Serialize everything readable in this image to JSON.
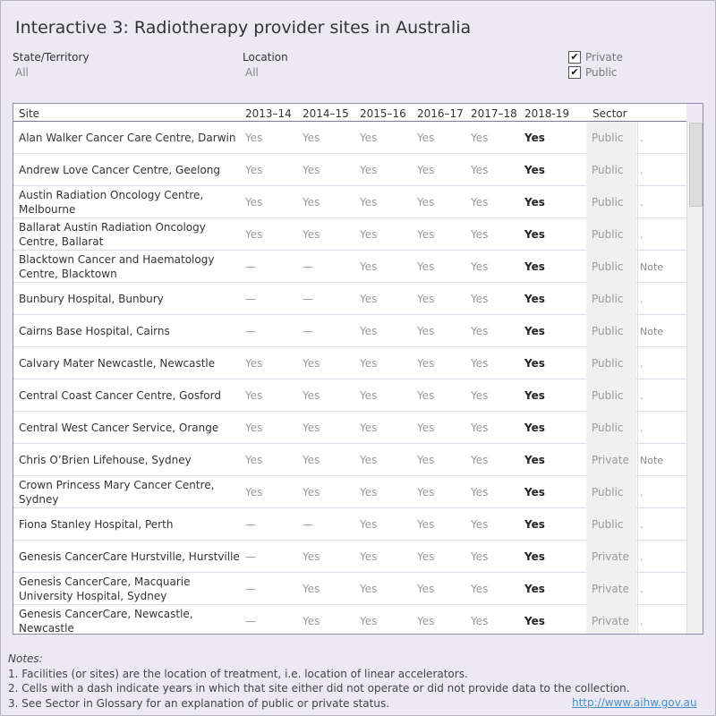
{
  "title": "Interactive 3: Radiotherapy provider sites in Australia",
  "filters": {
    "state": {
      "label": "State/Territory",
      "value": "All"
    },
    "location": {
      "label": "Location",
      "value": "All"
    }
  },
  "legend": {
    "private": {
      "label": "Private",
      "checked": "✔"
    },
    "public": {
      "label": "Public",
      "checked": "✔"
    }
  },
  "table": {
    "headers": [
      "Site",
      "2013–14",
      "2014–15",
      "2015–16",
      "2016–17",
      "2017–18",
      "2018-19",
      "Sector"
    ],
    "rows": [
      {
        "site": "Alan Walker Cancer Care Centre, Darwin",
        "years": [
          "Yes",
          "Yes",
          "Yes",
          "Yes",
          "Yes",
          "Yes"
        ],
        "sector": "Public",
        "note": "."
      },
      {
        "site": "Andrew Love Cancer Centre, Geelong",
        "years": [
          "Yes",
          "Yes",
          "Yes",
          "Yes",
          "Yes",
          "Yes"
        ],
        "sector": "Public",
        "note": "."
      },
      {
        "site": "Austin Radiation Oncology Centre, Melbourne",
        "years": [
          "Yes",
          "Yes",
          "Yes",
          "Yes",
          "Yes",
          "Yes"
        ],
        "sector": "Public",
        "note": "."
      },
      {
        "site": "Ballarat Austin Radiation Oncology Centre, Ballarat",
        "years": [
          "Yes",
          "Yes",
          "Yes",
          "Yes",
          "Yes",
          "Yes"
        ],
        "sector": "Public",
        "note": "."
      },
      {
        "site": "Blacktown Cancer and Haematology Centre, Blacktown",
        "years": [
          "—",
          "—",
          "Yes",
          "Yes",
          "Yes",
          "Yes"
        ],
        "sector": "Public",
        "note": "Note"
      },
      {
        "site": "Bunbury Hospital, Bunbury",
        "years": [
          "—",
          "—",
          "Yes",
          "Yes",
          "Yes",
          "Yes"
        ],
        "sector": "Public",
        "note": "."
      },
      {
        "site": "Cairns Base Hospital, Cairns",
        "years": [
          "—",
          "—",
          "Yes",
          "Yes",
          "Yes",
          "Yes"
        ],
        "sector": "Public",
        "note": "Note"
      },
      {
        "site": "Calvary Mater Newcastle, Newcastle",
        "years": [
          "Yes",
          "Yes",
          "Yes",
          "Yes",
          "Yes",
          "Yes"
        ],
        "sector": "Public",
        "note": "."
      },
      {
        "site": "Central Coast Cancer Centre, Gosford",
        "years": [
          "Yes",
          "Yes",
          "Yes",
          "Yes",
          "Yes",
          "Yes"
        ],
        "sector": "Public",
        "note": "."
      },
      {
        "site": "Central West Cancer Service, Orange",
        "years": [
          "Yes",
          "Yes",
          "Yes",
          "Yes",
          "Yes",
          "Yes"
        ],
        "sector": "Public",
        "note": "."
      },
      {
        "site": "Chris O’Brien Lifehouse, Sydney",
        "years": [
          "Yes",
          "Yes",
          "Yes",
          "Yes",
          "Yes",
          "Yes"
        ],
        "sector": "Private",
        "note": "Note"
      },
      {
        "site": "Crown Princess Mary Cancer Centre, Sydney",
        "years": [
          "Yes",
          "Yes",
          "Yes",
          "Yes",
          "Yes",
          "Yes"
        ],
        "sector": "Public",
        "note": "."
      },
      {
        "site": "Fiona Stanley Hospital, Perth",
        "years": [
          "—",
          "—",
          "Yes",
          "Yes",
          "Yes",
          "Yes"
        ],
        "sector": "Public",
        "note": "."
      },
      {
        "site": "Genesis CancerCare Hurstville, Hurstville",
        "years": [
          "—",
          "Yes",
          "Yes",
          "Yes",
          "Yes",
          "Yes"
        ],
        "sector": "Private",
        "note": "."
      },
      {
        "site": "Genesis CancerCare, Macquarie University Hospital, Sydney",
        "years": [
          "—",
          "Yes",
          "Yes",
          "Yes",
          "Yes",
          "Yes"
        ],
        "sector": "Private",
        "note": "."
      },
      {
        "site": "Genesis CancerCare, Newcastle, Newcastle",
        "years": [
          "—",
          "Yes",
          "Yes",
          "Yes",
          "Yes",
          "Yes"
        ],
        "sector": "Private",
        "note": "."
      }
    ]
  },
  "notes": {
    "heading": "Notes:",
    "lines": [
      "1. Facilities (or sites) are the location of treatment, i.e. location of linear accelerators.",
      "2. Cells with a dash indicate years in which that site either did not operate or did not provide data to the collection.",
      "3. See Sector in Glossary for an explanation of public or private status."
    ]
  },
  "link": "http://www.aihw.gov.au"
}
